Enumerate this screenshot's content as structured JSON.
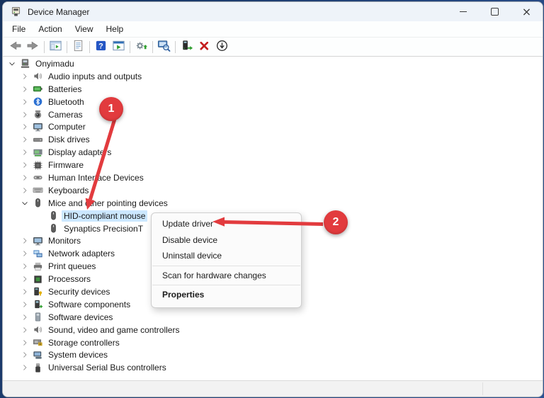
{
  "window": {
    "title": "Device Manager",
    "controls": [
      {
        "name": "minimize"
      },
      {
        "name": "maximize"
      },
      {
        "name": "close"
      }
    ]
  },
  "menubar": [
    {
      "label": "File"
    },
    {
      "label": "Action"
    },
    {
      "label": "View"
    },
    {
      "label": "Help"
    }
  ],
  "toolbar": [
    {
      "icon": "back-icon"
    },
    {
      "icon": "forward-icon"
    },
    {
      "icon": "separator"
    },
    {
      "icon": "show-console-tree-icon"
    },
    {
      "icon": "separator"
    },
    {
      "icon": "properties-icon"
    },
    {
      "icon": "separator"
    },
    {
      "icon": "help-icon"
    },
    {
      "icon": "export-list-icon"
    },
    {
      "icon": "separator"
    },
    {
      "icon": "add-drivers-icon"
    },
    {
      "icon": "separator"
    },
    {
      "icon": "scan-hardware-changes-icon"
    },
    {
      "icon": "separator"
    },
    {
      "icon": "update-driver-icon"
    },
    {
      "icon": "uninstall-device-icon"
    },
    {
      "icon": "disable-device-icon"
    }
  ],
  "tree": {
    "items": [
      {
        "label": "Onyimadu",
        "level": 0,
        "expander": "expanded",
        "icon": "pc-icon",
        "selected": false
      },
      {
        "label": "Audio inputs and outputs",
        "level": 1,
        "expander": "collapsed",
        "icon": "speaker-icon",
        "selected": false
      },
      {
        "label": "Batteries",
        "level": 1,
        "expander": "collapsed",
        "icon": "battery-icon",
        "selected": false
      },
      {
        "label": "Bluetooth",
        "level": 1,
        "expander": "collapsed",
        "icon": "bluetooth-icon",
        "selected": false
      },
      {
        "label": "Cameras",
        "level": 1,
        "expander": "collapsed",
        "icon": "camera-icon",
        "selected": false
      },
      {
        "label": "Computer",
        "level": 1,
        "expander": "collapsed",
        "icon": "monitor-icon",
        "selected": false
      },
      {
        "label": "Disk drives",
        "level": 1,
        "expander": "collapsed",
        "icon": "disk-icon",
        "selected": false
      },
      {
        "label": "Display adapters",
        "level": 1,
        "expander": "collapsed",
        "icon": "gpu-icon",
        "selected": false
      },
      {
        "label": "Firmware",
        "level": 1,
        "expander": "collapsed",
        "icon": "chip-icon",
        "selected": false
      },
      {
        "label": "Human Interface Devices",
        "level": 1,
        "expander": "collapsed",
        "icon": "hid-icon",
        "selected": false
      },
      {
        "label": "Keyboards",
        "level": 1,
        "expander": "collapsed",
        "icon": "keyboard-icon",
        "selected": false
      },
      {
        "label": "Mice and other pointing devices",
        "level": 1,
        "expander": "expanded",
        "icon": "mouse-icon",
        "selected": false
      },
      {
        "label": "HID-compliant mouse",
        "level": 2,
        "expander": null,
        "icon": "mouse-icon",
        "selected": true
      },
      {
        "label": "Synaptics PrecisionT",
        "level": 2,
        "expander": null,
        "icon": "mouse-icon",
        "selected": false
      },
      {
        "label": "Monitors",
        "level": 1,
        "expander": "collapsed",
        "icon": "monitor-icon",
        "selected": false
      },
      {
        "label": "Network adapters",
        "level": 1,
        "expander": "collapsed",
        "icon": "network-icon",
        "selected": false
      },
      {
        "label": "Print queues",
        "level": 1,
        "expander": "collapsed",
        "icon": "printer-icon",
        "selected": false
      },
      {
        "label": "Processors",
        "level": 1,
        "expander": "collapsed",
        "icon": "cpu-icon",
        "selected": false
      },
      {
        "label": "Security devices",
        "level": 1,
        "expander": "collapsed",
        "icon": "security-icon",
        "selected": false
      },
      {
        "label": "Software components",
        "level": 1,
        "expander": "collapsed",
        "icon": "software-component-icon",
        "selected": false
      },
      {
        "label": "Software devices",
        "level": 1,
        "expander": "collapsed",
        "icon": "software-device-icon",
        "selected": false
      },
      {
        "label": "Sound, video and game controllers",
        "level": 1,
        "expander": "collapsed",
        "icon": "speaker-icon",
        "selected": false
      },
      {
        "label": "Storage controllers",
        "level": 1,
        "expander": "collapsed",
        "icon": "storage-icon",
        "selected": false
      },
      {
        "label": "System devices",
        "level": 1,
        "expander": "collapsed",
        "icon": "system-icon",
        "selected": false
      },
      {
        "label": "Universal Serial Bus controllers",
        "level": 1,
        "expander": "collapsed",
        "icon": "usb-icon",
        "selected": false
      }
    ]
  },
  "context_menu": {
    "items": [
      {
        "type": "item",
        "label": "Update driver",
        "bold": false
      },
      {
        "type": "item",
        "label": "Disable device",
        "bold": false
      },
      {
        "type": "item",
        "label": "Uninstall device",
        "bold": false
      },
      {
        "type": "separator"
      },
      {
        "type": "item",
        "label": "Scan for hardware changes",
        "bold": false
      },
      {
        "type": "separator"
      },
      {
        "type": "item",
        "label": "Properties",
        "bold": true
      }
    ]
  },
  "annotations": {
    "accent_color": "#e23b3e",
    "steps": [
      {
        "label": "1",
        "target": "HID-compliant mouse"
      },
      {
        "label": "2",
        "target": "Update driver"
      }
    ]
  },
  "statusbar": {
    "text": ""
  }
}
